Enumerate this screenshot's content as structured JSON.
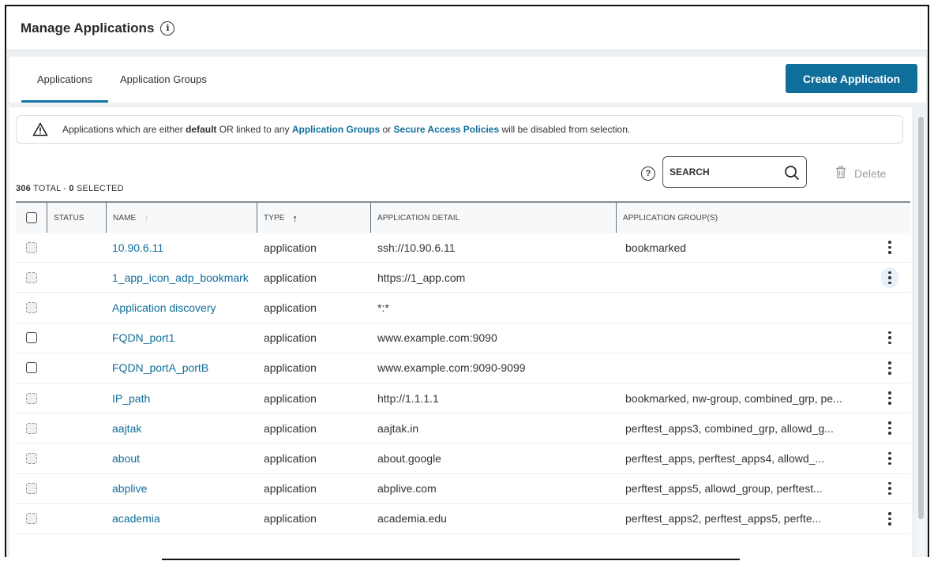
{
  "header": {
    "title": "Manage Applications",
    "info_icon": "info-icon"
  },
  "tabs": [
    {
      "label": "Applications",
      "active": true
    },
    {
      "label": "Application Groups",
      "active": false
    }
  ],
  "create_button": "Create Application",
  "notice": {
    "icon": "warning-icon",
    "text_1": "Applications which are either ",
    "bold_1": "default",
    "text_2": " OR linked to any ",
    "link_1": "Application Groups",
    "text_3": " or ",
    "link_2": "Secure Access Policies",
    "text_4": " will be disabled from selection."
  },
  "summary": {
    "total": "306",
    "total_label": " TOTAL - ",
    "selected": "0",
    "selected_label": " SELECTED"
  },
  "search": {
    "placeholder": "SEARCH",
    "value": ""
  },
  "delete_label": "Delete",
  "columns": [
    "STATUS",
    "NAME",
    "TYPE",
    "APPLICATION DETAIL",
    "APPLICATION GROUP(S)"
  ],
  "sort": {
    "column": "TYPE",
    "direction": "ascending"
  },
  "rows": [
    {
      "name": "10.90.6.11",
      "type": "application",
      "detail": "ssh://10.90.6.11",
      "groups": "bookmarked",
      "selectable": false,
      "menu": true
    },
    {
      "name": "1_app_icon_adp_bookmark",
      "type": "application",
      "detail": "https://1_app.com",
      "groups": "",
      "selectable": false,
      "menu": true,
      "menu_hover": true
    },
    {
      "name": "Application discovery",
      "type": "application",
      "detail": "*:*",
      "groups": "",
      "selectable": false,
      "menu": false
    },
    {
      "name": "FQDN_port1",
      "type": "application",
      "detail": "www.example.com:9090",
      "groups": "",
      "selectable": true,
      "menu": true
    },
    {
      "name": "FQDN_portA_portB",
      "type": "application",
      "detail": "www.example.com:9090-9099",
      "groups": "",
      "selectable": true,
      "menu": true
    },
    {
      "name": "IP_path",
      "type": "application",
      "detail": "http://1.1.1.1",
      "groups": "bookmarked, nw-group, combined_grp, pe...",
      "selectable": false,
      "menu": true
    },
    {
      "name": "aajtak",
      "type": "application",
      "detail": "aajtak.in",
      "groups": "perftest_apps3, combined_grp, allowd_g...",
      "selectable": false,
      "menu": true
    },
    {
      "name": "about",
      "type": "application",
      "detail": "about.google",
      "groups": "perftest_apps, perftest_apps4, allowd_...",
      "selectable": false,
      "menu": true
    },
    {
      "name": "abplive",
      "type": "application",
      "detail": "abplive.com",
      "groups": "perftest_apps5, allowd_group, perftest...",
      "selectable": false,
      "menu": true
    },
    {
      "name": "academia",
      "type": "application",
      "detail": "academia.edu",
      "groups": "perftest_apps2, perftest_apps5, perfte...",
      "selectable": false,
      "menu": true
    }
  ],
  "colors": {
    "accent": "#0f6e9a",
    "tab_underline": "#1577a6"
  }
}
